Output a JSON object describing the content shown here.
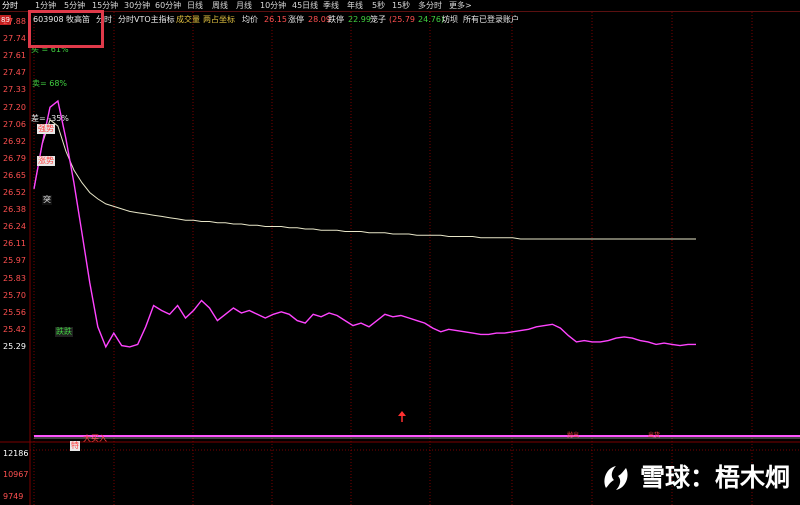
{
  "tabs": [
    "分时",
    "1分钟",
    "5分钟",
    "15分钟",
    "30分钟",
    "60分钟",
    "日线",
    "周线",
    "月线",
    "10分钟",
    "45日线",
    "季线",
    "年线",
    "5秒",
    "15秒",
    "多分时",
    "更多>"
  ],
  "corner_badge": "89",
  "info": {
    "code": "603908",
    "name": "牧高笛",
    "mode": "分时",
    "vto": "分时VTO主指标",
    "volume": "成交量",
    "twoaxis": "两占坐标",
    "avg_label": "均价",
    "avg_value": "26.15",
    "limit_up_label": "涨停",
    "limit_up_value": "28.09",
    "limit_down_label": "跌停",
    "limit_down_value": "22.99",
    "nut_label": "笼子",
    "nut_open": "(25.79",
    "nut_close": "24.76)",
    "trash_label": "坊坝",
    "accounts": "所有已登录账户"
  },
  "price_ticks": [
    "27.88",
    "27.74",
    "27.61",
    "27.47",
    "27.33",
    "27.20",
    "27.06",
    "26.92",
    "26.79",
    "26.65",
    "26.52",
    "26.38",
    "26.24",
    "26.11",
    "25.97",
    "25.83",
    "25.70",
    "25.56",
    "25.42",
    "25.29"
  ],
  "volume_ticks": [
    "12186",
    "10967",
    "9749"
  ],
  "annotations": {
    "buy_pct": "买 = 61%",
    "sell_pct": "卖= 68%",
    "diff_pct": "差= -35%",
    "label_qiangshi": "强势",
    "label_zhangshi": "涨势",
    "label_huang": "突",
    "label_diedie": "跌跌",
    "label_te": "特",
    "label_dazhangru": "大买入",
    "label_small1": "抛出",
    "label_small2": "出货"
  },
  "colors": {
    "price_line": "#ff44ff",
    "avg_line": "#e8e6c8",
    "grid": "#7a0000",
    "base_line": "#ff55ff",
    "axis_text": "#ff5050",
    "highlight_box": "#e03a4a"
  },
  "chart_data": {
    "type": "line",
    "ylim": [
      25.29,
      27.88
    ],
    "series": [
      {
        "values": [
          26.55,
          26.9,
          27.2,
          27.25,
          26.95,
          26.6,
          26.2,
          25.8,
          25.45,
          25.29,
          25.4,
          25.3,
          25.29,
          25.31,
          25.45,
          25.62,
          25.58,
          25.55,
          25.62,
          25.52,
          25.58,
          25.66,
          25.6,
          25.5,
          25.55,
          25.6,
          25.56,
          25.58,
          25.55,
          25.52,
          25.55,
          25.57,
          25.55,
          25.5,
          25.48,
          25.55,
          25.53,
          25.56,
          25.54,
          25.5,
          25.46,
          25.48,
          25.45,
          25.5,
          25.55,
          25.53,
          25.54,
          25.52,
          25.5,
          25.48,
          25.44,
          25.41,
          25.43,
          25.42,
          25.41,
          25.4,
          25.39,
          25.39,
          25.4,
          25.4,
          25.41,
          25.42,
          25.43,
          25.45,
          25.46,
          25.47,
          25.44,
          25.38,
          25.33,
          25.34,
          25.33,
          25.33,
          25.34,
          25.36,
          25.37,
          25.36,
          25.34,
          25.33,
          25.31,
          25.32,
          25.31,
          25.3,
          25.31,
          25.31
        ]
      },
      {
        "values": [
          26.55,
          26.9,
          27.1,
          27.05,
          26.85,
          26.7,
          26.6,
          26.52,
          26.47,
          26.43,
          26.41,
          26.39,
          26.37,
          26.36,
          26.35,
          26.34,
          26.33,
          26.32,
          26.31,
          26.3,
          26.3,
          26.29,
          26.29,
          26.28,
          26.28,
          26.27,
          26.27,
          26.26,
          26.26,
          26.25,
          26.25,
          26.25,
          26.24,
          26.24,
          26.23,
          26.23,
          26.22,
          26.22,
          26.22,
          26.21,
          26.21,
          26.21,
          26.2,
          26.2,
          26.2,
          26.19,
          26.19,
          26.19,
          26.18,
          26.18,
          26.18,
          26.18,
          26.17,
          26.17,
          26.17,
          26.17,
          26.16,
          26.16,
          26.16,
          26.16,
          26.16,
          26.15,
          26.15,
          26.15,
          26.15,
          26.15,
          26.15,
          26.15,
          26.15,
          26.15,
          26.15,
          26.15,
          26.15,
          26.15,
          26.15,
          26.15,
          26.15,
          26.15,
          26.15,
          26.15,
          26.15,
          26.15,
          26.15,
          26.15
        ]
      }
    ]
  }
}
